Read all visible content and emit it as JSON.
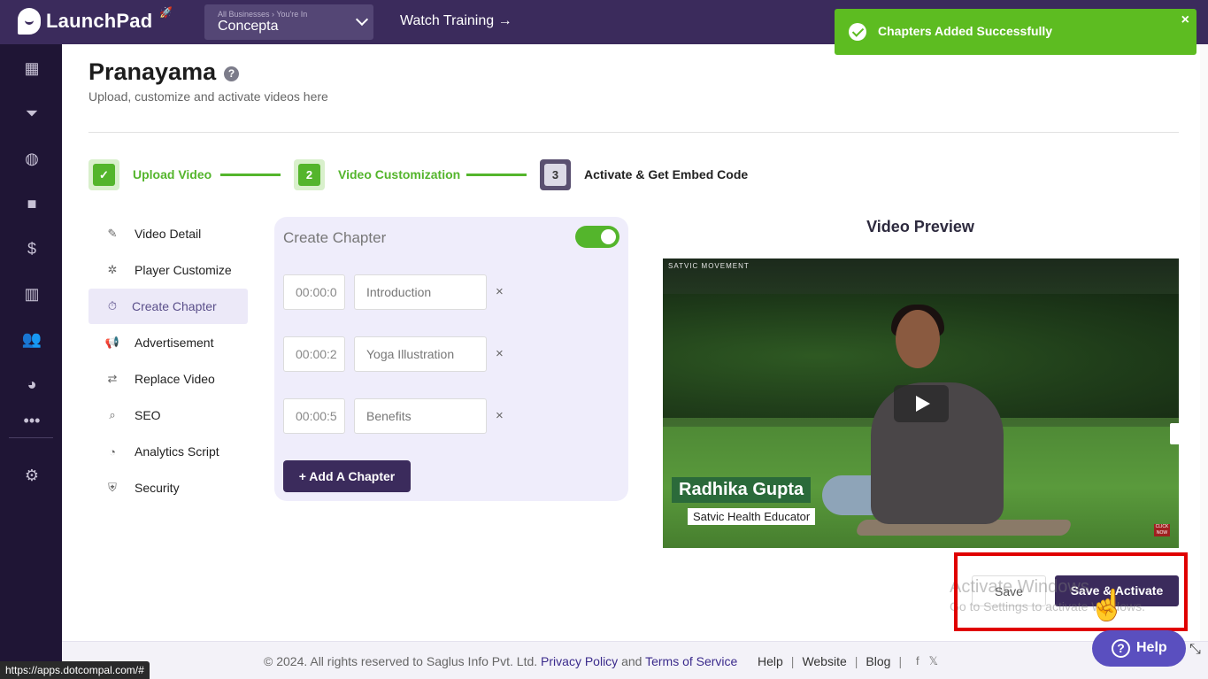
{
  "app": {
    "name": "LaunchPad"
  },
  "topbar": {
    "business_crumb": "All Businesses  ›  You're In",
    "business_name": "Concepta",
    "watch_training": "Watch Training →"
  },
  "toast": {
    "message": "Chapters Added Successfully",
    "close": "×"
  },
  "page": {
    "title": "Pranayama",
    "help": "?",
    "subtitle": "Upload, customize and activate videos here"
  },
  "steps": [
    {
      "label": "Upload Video",
      "marker": "✓",
      "state": "done"
    },
    {
      "label": "Video Customization",
      "marker": "2",
      "state": "done"
    },
    {
      "label": "Activate & Get Embed Code",
      "marker": "3",
      "state": "current"
    }
  ],
  "menu": [
    {
      "label": "Video Detail",
      "icon": "edit-icon",
      "glyph": "✎"
    },
    {
      "label": "Player Customize",
      "icon": "cog-icon",
      "glyph": "✲"
    },
    {
      "label": "Create Chapter",
      "icon": "timer-icon",
      "glyph": "⏱"
    },
    {
      "label": "Advertisement",
      "icon": "megaphone-icon",
      "glyph": "📢"
    },
    {
      "label": "Replace Video",
      "icon": "swap-icon",
      "glyph": "⇄"
    },
    {
      "label": "SEO",
      "icon": "search-icon",
      "glyph": "⌕"
    },
    {
      "label": "Analytics Script",
      "icon": "chart-icon",
      "glyph": "◔"
    },
    {
      "label": "Security",
      "icon": "shield-icon",
      "glyph": "⛨"
    }
  ],
  "chapters": {
    "title": "Create Chapter",
    "enabled": true,
    "items": [
      {
        "time": "00:00:0",
        "name": "Introduction",
        "remove": "×"
      },
      {
        "time": "00:00:2",
        "name": "Yoga Illustration",
        "remove": "×"
      },
      {
        "time": "00:00:5",
        "name": "Benefits",
        "remove": "×"
      }
    ],
    "add_label": "+ Add A Chapter"
  },
  "preview": {
    "title": "Video Preview",
    "channel": "SATVIC MOVEMENT",
    "person_name": "Radhika Gupta",
    "person_role": "Satvic Health Educator",
    "click_now": "CLICK NOW"
  },
  "actions": {
    "save": "Save",
    "save_activate": "Save & Activate",
    "watermark_title": "Activate Windows",
    "watermark_sub": "Go to Settings to activate Windows."
  },
  "footer": {
    "copyright": "©  2024. All rights reserved to Saglus Info Pvt. Ltd.",
    "privacy": "Privacy Policy",
    "and": "and",
    "terms": "Terms of Service",
    "help": "Help",
    "website": "Website",
    "blog": "Blog",
    "sep": "|",
    "facebook": "f",
    "twitter": "𝕏"
  },
  "help_widget": {
    "label": "Help",
    "glyph": "?"
  },
  "status_url": "https://apps.dotcompal.com/#",
  "colors": {
    "brand": "#3b2b5c",
    "success": "#54b52c",
    "toast": "#5dbc21",
    "highlight": "#e00000"
  }
}
